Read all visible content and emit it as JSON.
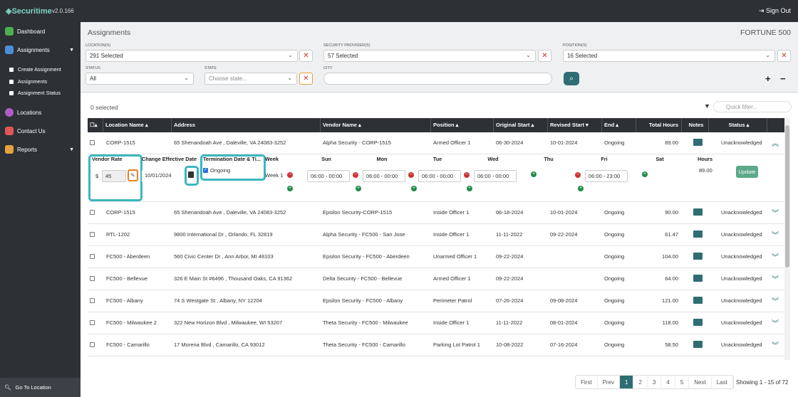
{
  "app": {
    "logo_text": "Securitime",
    "version": "v2.0.166",
    "sign_out": "Sign Out"
  },
  "sidebar": {
    "items": [
      {
        "label": "Dashboard",
        "icon": "dashboard-icon",
        "color": "#4caf50"
      },
      {
        "label": "Assignments",
        "icon": "assignments-icon",
        "color": "#4a90d9"
      },
      {
        "label": "Locations",
        "icon": "location-pin-icon",
        "color": "#b05cc6"
      },
      {
        "label": "Contact Us",
        "icon": "truck-icon",
        "color": "#e05555"
      },
      {
        "label": "Reports",
        "icon": "reports-icon",
        "color": "#e6a23c"
      }
    ],
    "sub_items": [
      "Create Assignment",
      "Assignments",
      "Assignment Status"
    ],
    "go_to_location": "Go To Location"
  },
  "header": {
    "title": "Assignments",
    "org": "FORTUNE 500"
  },
  "filters": {
    "locations_label": "LOCATION(S)",
    "locations_value": "291 Selected",
    "providers_label": "SECURITY PROVIDER(S)",
    "providers_value": "57 Selected",
    "positions_label": "POSITION(S)",
    "positions_value": "16 Selected",
    "status_label": "STATUS",
    "status_value": "All",
    "state_label": "STATE",
    "state_placeholder": "Choose state...",
    "city_label": "CITY",
    "city_value": ""
  },
  "list": {
    "selected_count": "0 selected",
    "quick_filter_placeholder": "Quick filter..."
  },
  "columns": [
    "Location Name",
    "Address",
    "Vendor Name",
    "Position",
    "Original Start",
    "Revised Start",
    "End",
    "Total Hours",
    "Notes",
    "Status"
  ],
  "rows": [
    {
      "location": "CORP-1515",
      "address": "65 Shenandoah Ave , Daleville, VA 24083-3252",
      "vendor": "Alpha Security - CORP-1515",
      "position": "Armed Officer 1",
      "orig": "06-30-2024",
      "revised": "10-01-2024",
      "end": "Ongoing",
      "hours": "89.00",
      "status": "Unacknowledged"
    },
    {
      "location": "CORP-1515",
      "address": "65 Shenandoah Ave , Daleville, VA 24083-3252",
      "vendor": "Epsilon Security-CORP-1515",
      "position": "Inside Officer 1",
      "orig": "06-18-2024",
      "revised": "10-01-2024",
      "end": "Ongoing",
      "hours": "90.00",
      "status": "Unacknowledged"
    },
    {
      "location": "RTL-1202",
      "address": "9800 International Dr , Orlando, FL 32819",
      "vendor": "Alpha Security - FC500 - San Jose",
      "position": "Inside Officer 1",
      "orig": "11-11-2022",
      "revised": "09-22-2024",
      "end": "Ongoing",
      "hours": "61.47",
      "status": "Unacknowledged"
    },
    {
      "location": "FC500 - Aberdeen",
      "address": "560 Civic Center Dr , Ann Arbor, MI 48103",
      "vendor": "Epsilon Security - FC500 - Aberdeen",
      "position": "Unarmed Officer 1",
      "orig": "09-22-2024",
      "revised": "",
      "end": "Ongoing",
      "hours": "104.00",
      "status": "Unacknowledged"
    },
    {
      "location": "FC500 - Bellevue",
      "address": "326 E Main St #6496 , Thousand Oaks, CA 91362",
      "vendor": "Delta Security - FC500 - Bellevue",
      "position": "Armed Officer 1",
      "orig": "09-22-2024",
      "revised": "",
      "end": "Ongoing",
      "hours": "64.00",
      "status": "Unacknowledged"
    },
    {
      "location": "FC500 - Albany",
      "address": "74 S Westgate St , Albany, NY 12204",
      "vendor": "Epsilon Security - FC500 - Albany",
      "position": "Perimeter Patrol",
      "orig": "07-26-2024",
      "revised": "09-08-2024",
      "end": "Ongoing",
      "hours": "121.00",
      "status": "Unacknowledged"
    },
    {
      "location": "FC500 - Milwaukee 2",
      "address": "322 New Horizon Blvd , Milwaukee, WI 53207",
      "vendor": "Theta Security - FC500 - Milwaukee",
      "position": "Inside Officer 1",
      "orig": "11-11-2022",
      "revised": "08-01-2024",
      "end": "Ongoing",
      "hours": "118.00",
      "status": "Unacknowledged"
    },
    {
      "location": "FC500 - Camarillo",
      "address": "17 Morena Blvd , Camarillo, CA 93012",
      "vendor": "Theta Security - FC500 - Camarillo",
      "position": "Parking Lot Patrol 1",
      "orig": "10-08-2022",
      "revised": "07-16-2024",
      "end": "Ongoing",
      "hours": "58.50",
      "status": "Unacknowledged"
    }
  ],
  "detail": {
    "vendor_rate_label": "Vendor Rate",
    "currency": "$",
    "rate": "45",
    "effective_label": "Change Effective Date",
    "effective_date": "10/01/2024",
    "termination_label": "Termination Date & Ti...",
    "ongoing_label": "Ongoing",
    "week_label": "Week",
    "week_value": "Week 1",
    "days": [
      "Sun",
      "Mon",
      "Tue",
      "Wed",
      "Thu",
      "Fri",
      "Sat"
    ],
    "times": [
      "06:00 - 00:00",
      "06:00 - 00:00",
      "06:00 - 00:00",
      "06:00 - 00:00",
      "",
      "06:00 - 23:00",
      ""
    ],
    "hours_label": "Hours",
    "hours_value": "89.00",
    "update_label": "Update"
  },
  "pagination": {
    "pages": [
      "First",
      "Prev",
      "1",
      "2",
      "3",
      "4",
      "5",
      "Next",
      "Last"
    ],
    "active": "1",
    "showing": "Showing 1 - 15 of 72"
  },
  "colors": {
    "teal": "#2e6e73",
    "highlight": "#3bb7bf",
    "dark": "#2d3035"
  }
}
